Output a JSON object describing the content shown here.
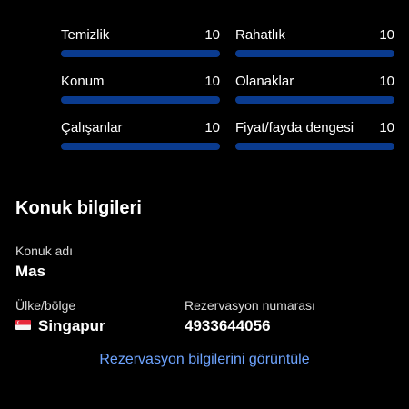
{
  "ratings": [
    {
      "label": "Temizlik",
      "score": "10",
      "fill": 1.0
    },
    {
      "label": "Rahatlık",
      "score": "10",
      "fill": 1.0
    },
    {
      "label": "Konum",
      "score": "10",
      "fill": 1.0
    },
    {
      "label": "Olanaklar",
      "score": "10",
      "fill": 1.0
    },
    {
      "label": "Çalışanlar",
      "score": "10",
      "fill": 1.0
    },
    {
      "label": "Fiyat/fayda dengesi",
      "score": "10",
      "fill": 1.0
    }
  ],
  "guest": {
    "section_title": "Konuk bilgileri",
    "name_label": "Konuk adı",
    "name_value": "Mas",
    "country_label": "Ülke/bölge",
    "country_value": "Singapur",
    "country_flag_icon": "singapore-flag-icon",
    "reservation_label": "Rezervasyon numarası",
    "reservation_value": "4933644056"
  },
  "actions": {
    "view_reservation_label": "Rezervasyon bilgilerini görüntüle"
  },
  "colors": {
    "background": "#000000",
    "bar_fill": "#0a3b8f",
    "link": "#6ea4ff"
  }
}
